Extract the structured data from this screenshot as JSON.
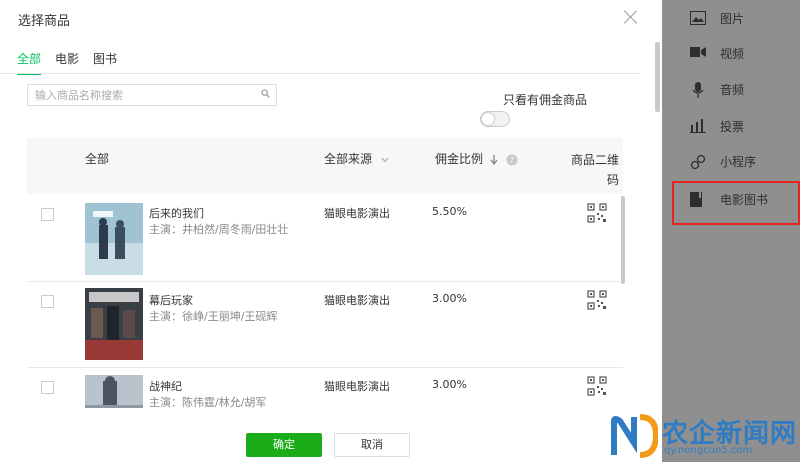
{
  "dialog": {
    "title": "选择商品",
    "tabs": [
      {
        "label": "全部",
        "active": true
      },
      {
        "label": "电影"
      },
      {
        "label": "图书"
      }
    ],
    "search": {
      "placeholder": "输入商品名称搜索",
      "value": ""
    },
    "filter": {
      "label": "只看有佣金商品",
      "on": false
    },
    "table": {
      "headers": {
        "all": "全部",
        "source": "全部来源",
        "rate": "佣金比例",
        "qr": "商品二维码"
      },
      "rows": [
        {
          "name": "后来的我们",
          "cast": "主演：井柏然/周冬雨/田壮壮",
          "source": "猫眼电影演出",
          "rate": "5.50%"
        },
        {
          "name": "幕后玩家",
          "cast": "主演：徐峥/王丽坤/王砚辉",
          "source": "猫眼电影演出",
          "rate": "3.00%"
        },
        {
          "name": "战神纪",
          "cast": "主演：陈伟霆/林允/胡军",
          "source": "猫眼电影演出",
          "rate": "3.00%"
        }
      ]
    },
    "buttons": {
      "ok": "确定",
      "cancel": "取消"
    }
  },
  "sidebar": {
    "items": [
      {
        "label": "图片",
        "icon": "image-icon"
      },
      {
        "label": "视频",
        "icon": "video-icon"
      },
      {
        "label": "音频",
        "icon": "microphone-icon"
      },
      {
        "label": "投票",
        "icon": "bar-chart-icon"
      },
      {
        "label": "小程序",
        "icon": "link-icon"
      },
      {
        "label": "电影图书",
        "icon": "book-icon"
      }
    ],
    "highlight_color": "#e62424"
  },
  "watermark": {
    "title": "农企新闻网",
    "url": "qy.nongcun5.com"
  },
  "colors": {
    "accent": "#07c160",
    "primary_button": "#1aad19"
  }
}
